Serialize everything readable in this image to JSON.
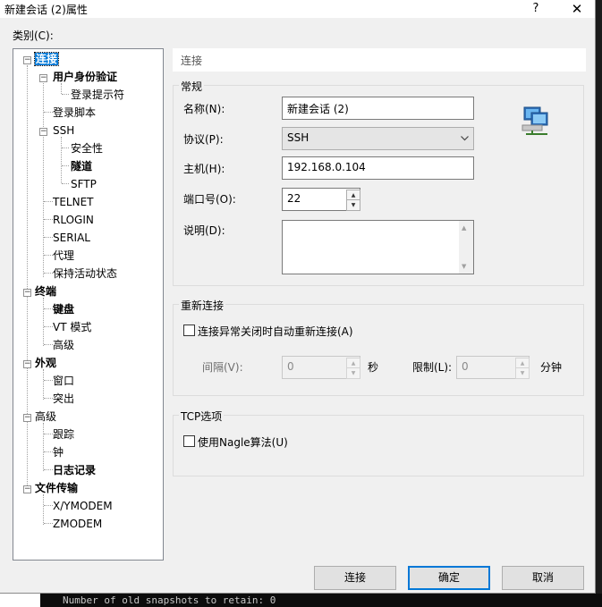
{
  "window": {
    "title": "新建会话 (2)属性",
    "help": "?",
    "close": "✕"
  },
  "category_label": "类别(C):",
  "tree": [
    {
      "label": "连接",
      "bold": true,
      "selected": true
    },
    {
      "label": "用户身份验证",
      "bold": true
    },
    {
      "label": "登录提示符"
    },
    {
      "label": "登录脚本"
    },
    {
      "label": "SSH"
    },
    {
      "label": "安全性"
    },
    {
      "label": "隧道",
      "bold": true
    },
    {
      "label": "SFTP"
    },
    {
      "label": "TELNET"
    },
    {
      "label": "RLOGIN"
    },
    {
      "label": "SERIAL"
    },
    {
      "label": "代理"
    },
    {
      "label": "保持活动状态"
    },
    {
      "label": "终端",
      "bold": true
    },
    {
      "label": "键盘",
      "bold": true
    },
    {
      "label": "VT 模式"
    },
    {
      "label": "高级"
    },
    {
      "label": "外观",
      "bold": true
    },
    {
      "label": "窗口"
    },
    {
      "label": "突出"
    },
    {
      "label": "高级"
    },
    {
      "label": "跟踪"
    },
    {
      "label": "钟"
    },
    {
      "label": "日志记录",
      "bold": true
    },
    {
      "label": "文件传输",
      "bold": true
    },
    {
      "label": "X/YMODEM"
    },
    {
      "label": "ZMODEM"
    }
  ],
  "header": "连接",
  "general": {
    "title": "常规",
    "name_label": "名称(N):",
    "name_value": "新建会话 (2)",
    "protocol_label": "协议(P):",
    "protocol_value": "SSH",
    "host_label": "主机(H):",
    "host_value": "192.168.0.104",
    "port_label": "端口号(O):",
    "port_value": "22",
    "desc_label": "说明(D):",
    "desc_value": ""
  },
  "reconnect": {
    "title": "重新连接",
    "checkbox_label": "连接异常关闭时自动重新连接(A)",
    "interval_label": "间隔(V):",
    "interval_value": "0",
    "interval_unit": "秒",
    "limit_label": "限制(L):",
    "limit_value": "0",
    "limit_unit": "分钟"
  },
  "tcp": {
    "title": "TCP选项",
    "checkbox_label": "使用Nagle算法(U)"
  },
  "buttons": {
    "connect": "连接",
    "ok": "确定",
    "cancel": "取消"
  },
  "background_terminal": "Number of old snapshots to retain: 0",
  "colors": {
    "accent": "#0078d7",
    "dialog_bg": "#f0f0f0"
  }
}
